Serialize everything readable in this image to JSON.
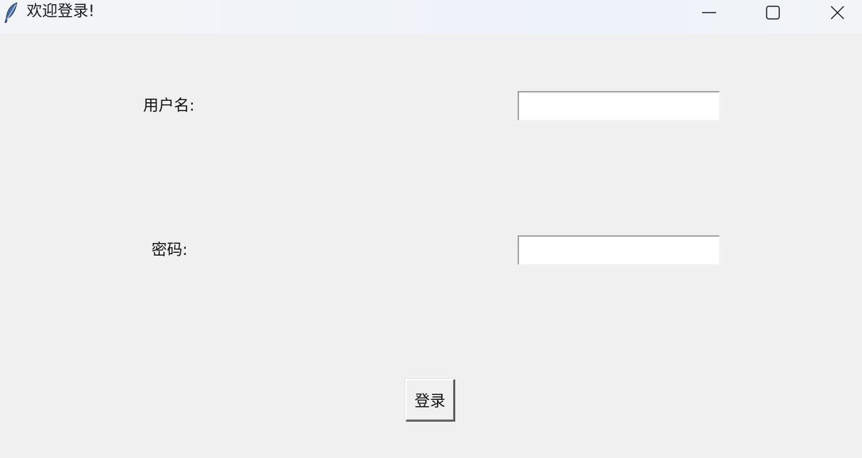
{
  "window": {
    "title": "欢迎登录!",
    "icon": "feather-icon",
    "controls": {
      "minimize_icon": "minimize-icon",
      "maximize_icon": "maximize-icon",
      "close_icon": "close-icon"
    }
  },
  "form": {
    "username_label": "用户名:",
    "username_value": "",
    "password_label": "密码:",
    "password_value": "",
    "login_button": "登录"
  }
}
